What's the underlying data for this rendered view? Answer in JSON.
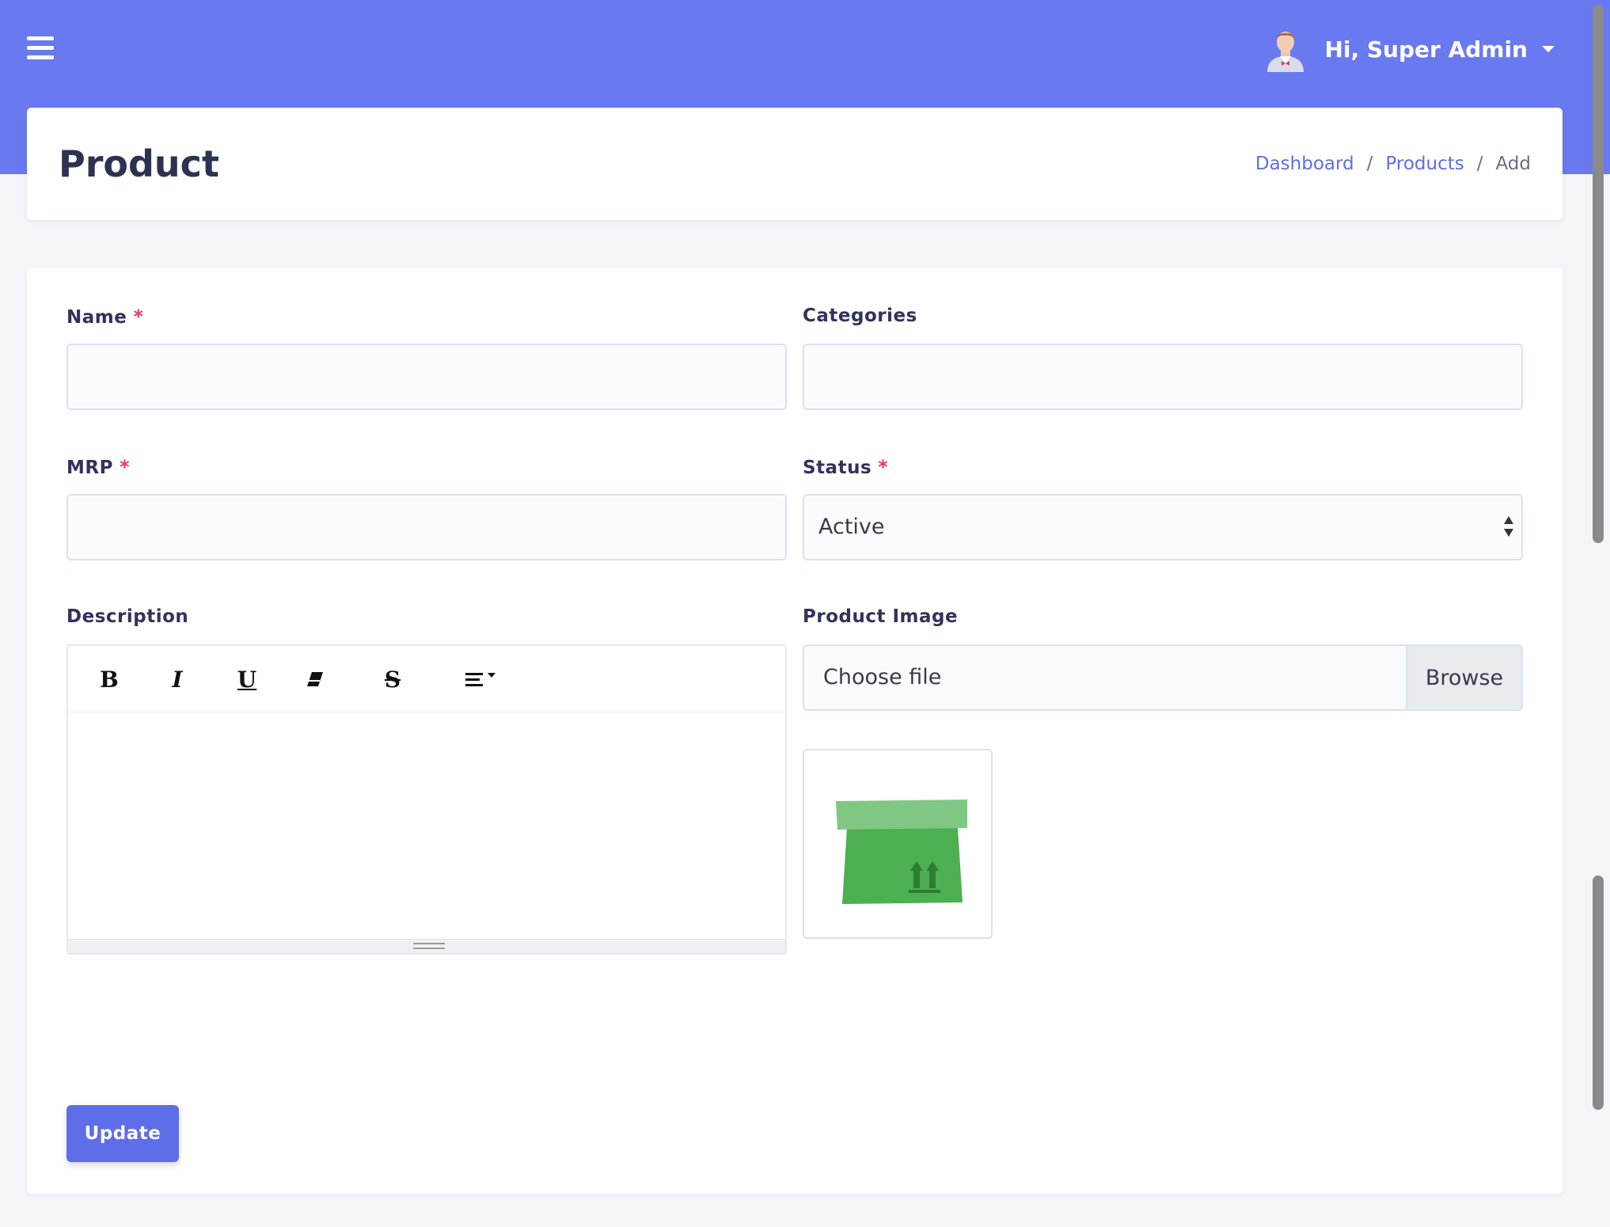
{
  "navbar": {
    "menu_icon": "hamburger-icon",
    "user_greeting": "Hi, Super Admin",
    "avatar_icon": "admin-avatar-icon"
  },
  "header": {
    "title": "Product",
    "breadcrumb": [
      {
        "label": "Dashboard"
      },
      {
        "label": "Products"
      },
      {
        "label": "Add"
      }
    ],
    "separator": "/"
  },
  "form": {
    "name": {
      "label": "Name",
      "required_mark": "*",
      "value": ""
    },
    "categories": {
      "label": "Categories",
      "value": ""
    },
    "mrp": {
      "label": "MRP",
      "required_mark": "*",
      "value": ""
    },
    "status": {
      "label": "Status",
      "required_mark": "*",
      "selected": "Active"
    },
    "description": {
      "label": "Description",
      "toolbar": [
        "bold",
        "italic",
        "underline",
        "eraser",
        "strikethrough",
        "align"
      ],
      "toolbar_glyphs": {
        "bold": "B",
        "italic": "I",
        "underline": "U",
        "strike": "S"
      }
    },
    "product_image": {
      "label": "Product Image",
      "file_placeholder": "Choose file",
      "browse_label": "Browse",
      "preview_icon": "package-box-icon"
    },
    "submit_label": "Update"
  },
  "colors": {
    "primary": "#6979f0",
    "button": "#5e6ee8",
    "link": "#5d6ee6",
    "required": "#f5365c",
    "box_green": "#4caf50"
  }
}
